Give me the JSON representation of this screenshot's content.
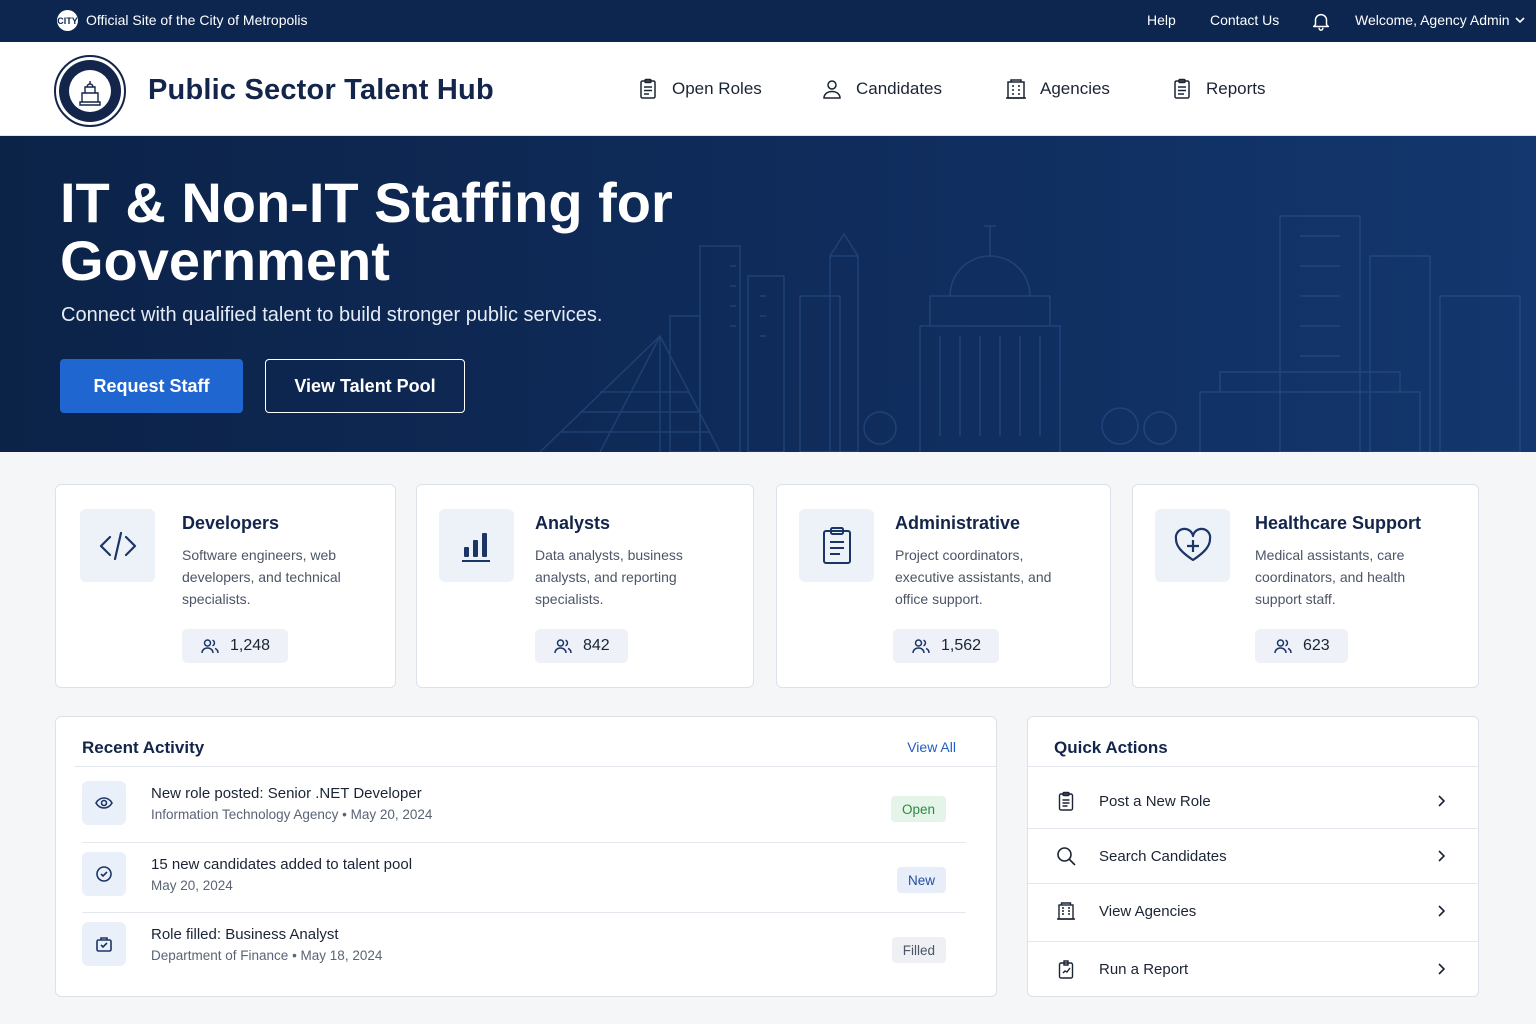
{
  "utility": {
    "seal_text": "CITY",
    "official": "Official Site of the City of Metropolis",
    "help": "Help",
    "contact": "Contact Us",
    "welcome": "Welcome, Agency Admin"
  },
  "header": {
    "brand": "Public Sector Talent Hub",
    "nav": [
      {
        "label": "Open Roles",
        "icon": "clipboard-icon"
      },
      {
        "label": "Candidates",
        "icon": "user-icon"
      },
      {
        "label": "Agencies",
        "icon": "building-icon"
      },
      {
        "label": "Reports",
        "icon": "report-icon"
      }
    ]
  },
  "hero": {
    "title": "IT & Non-IT Staffing for Government",
    "subtitle": "Connect with qualified talent to build stronger public services.",
    "primary_cta": "Request Staff",
    "secondary_cta": "View Talent Pool"
  },
  "categories": [
    {
      "title": "Developers",
      "description": "Software engineers, web developers, and technical specialists.",
      "count": "1,248",
      "icon": "code-icon"
    },
    {
      "title": "Analysts",
      "description": "Data analysts, business analysts, and reporting specialists.",
      "count": "842",
      "icon": "bar-chart-icon"
    },
    {
      "title": "Administrative",
      "description": "Project coordinators, executive assistants, and office support.",
      "count": "1,562",
      "icon": "clipboard-icon"
    },
    {
      "title": "Healthcare Support",
      "description": "Medical assistants, care coordinators, and health support staff.",
      "count": "623",
      "icon": "heart-plus-icon"
    }
  ],
  "activity": {
    "title": "Recent Activity",
    "view_all": "View All",
    "items": [
      {
        "title": "New role posted:  Senior .NET Developer",
        "meta": "Information Technology Agency   •   May 20, 2024",
        "badge": "Open"
      },
      {
        "title": "15 new candidates added to talent pool",
        "meta": "May 20, 2024",
        "badge": "New"
      },
      {
        "title": "Role filled:  Business Analyst",
        "meta": "Department of Finance   •   May 18, 2024",
        "badge": "Filled"
      }
    ]
  },
  "quick_actions": {
    "title": "Quick Actions",
    "items": [
      {
        "label": "Post a New Role",
        "icon": "clipboard-icon"
      },
      {
        "label": "Search Candidates",
        "icon": "search-icon"
      },
      {
        "label": "View Agencies",
        "icon": "building-icon"
      },
      {
        "label": "Run a Report",
        "icon": "report-icon"
      }
    ]
  },
  "colors": {
    "navy": "#0d2650",
    "primary": "#1f66d1",
    "open_badge": "#2d8a43"
  }
}
